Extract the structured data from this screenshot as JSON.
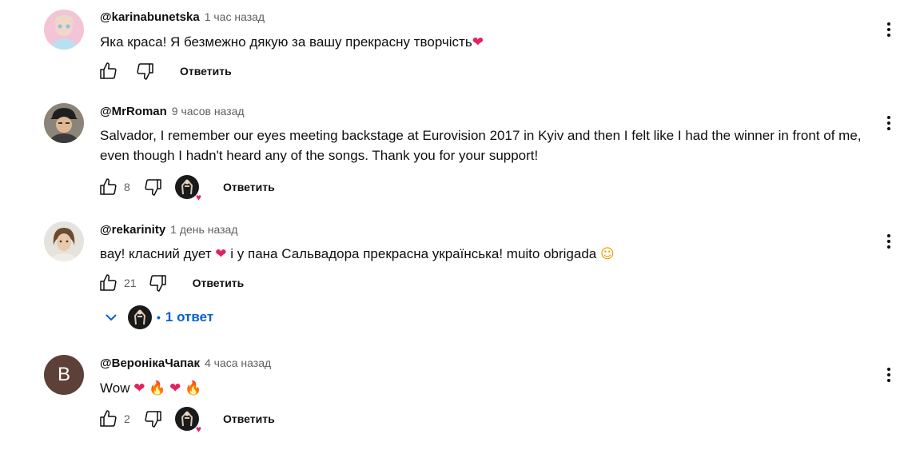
{
  "comments": [
    {
      "author": "@karinabunetska",
      "time": "1 час назад",
      "text": "Яка краса! Я безмежно дякую за вашу прекрасну творчість",
      "text_emoji": "❤",
      "likes": "",
      "reply_label": "Ответить",
      "avatar": "photo-girl-pink"
    },
    {
      "author": "@MrRoman",
      "time": "9 часов назад",
      "text": "Salvador, I remember our eyes meeting backstage at Eurovision 2017 in Kyiv and then I felt like I had the winner in front of me, even though I hadn't heard any of the songs. Thank you for your support!",
      "likes": "8",
      "reply_label": "Ответить",
      "avatar": "photo-man-cap"
    },
    {
      "author": "@rekarinity",
      "time": "1 день назад",
      "text_part1": "вау! класний дует",
      "text_emoji1": "❤",
      "text_part2": "і у пана Сальвадора прекрасна українська! muito obrigada",
      "text_emoji2": "☺",
      "likes": "21",
      "reply_label": "Ответить",
      "replies_label": "1 ответ",
      "replies_dot": "•",
      "avatar": "photo-woman"
    },
    {
      "author": "@ВеронікаЧапак",
      "time": "4 часа назад",
      "text": "Wow",
      "text_emojis": [
        "❤",
        "🔥",
        "❤",
        "🔥"
      ],
      "likes": "2",
      "reply_label": "Ответить",
      "avatar_letter": "В",
      "avatar_color": "#5d4037"
    }
  ],
  "icons": {
    "like": "thumb-up-icon",
    "dislike": "thumb-down-icon",
    "menu": "more-vert-icon",
    "expand": "chevron-down-icon",
    "creator_heart": "creator-heart-icon"
  },
  "colors": {
    "link": "#065fd4",
    "secondary_text": "#606060",
    "heart": "#e0245e"
  }
}
